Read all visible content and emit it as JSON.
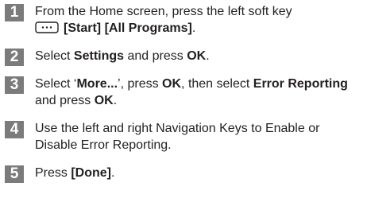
{
  "steps": [
    {
      "number": "1",
      "line1": "From the Home screen, press the left soft key",
      "start": "[Start]",
      "all_programs": "[All Programs]",
      "end": "."
    },
    {
      "number": "2",
      "t1": "Select ",
      "settings": "Settings",
      "t2": " and press ",
      "ok": "OK",
      "t3": "."
    },
    {
      "number": "3",
      "t1": "Select ‘",
      "more": "More...",
      "t2": "’, press ",
      "ok1": "OK",
      "t3": ", then select ",
      "error_reporting": "Error Reporting",
      "t4": " and press ",
      "ok2": "OK",
      "t5": "."
    },
    {
      "number": "4",
      "text": "Use the left and right Navigation Keys to Enable or Disable Error Reporting."
    },
    {
      "number": "5",
      "t1": "Press ",
      "done": "[Done]",
      "t2": "."
    }
  ],
  "icons": {
    "softkey": "left-soft-key-icon"
  },
  "colors": {
    "step_badge": "#7b7b7b",
    "text": "#231f20"
  }
}
